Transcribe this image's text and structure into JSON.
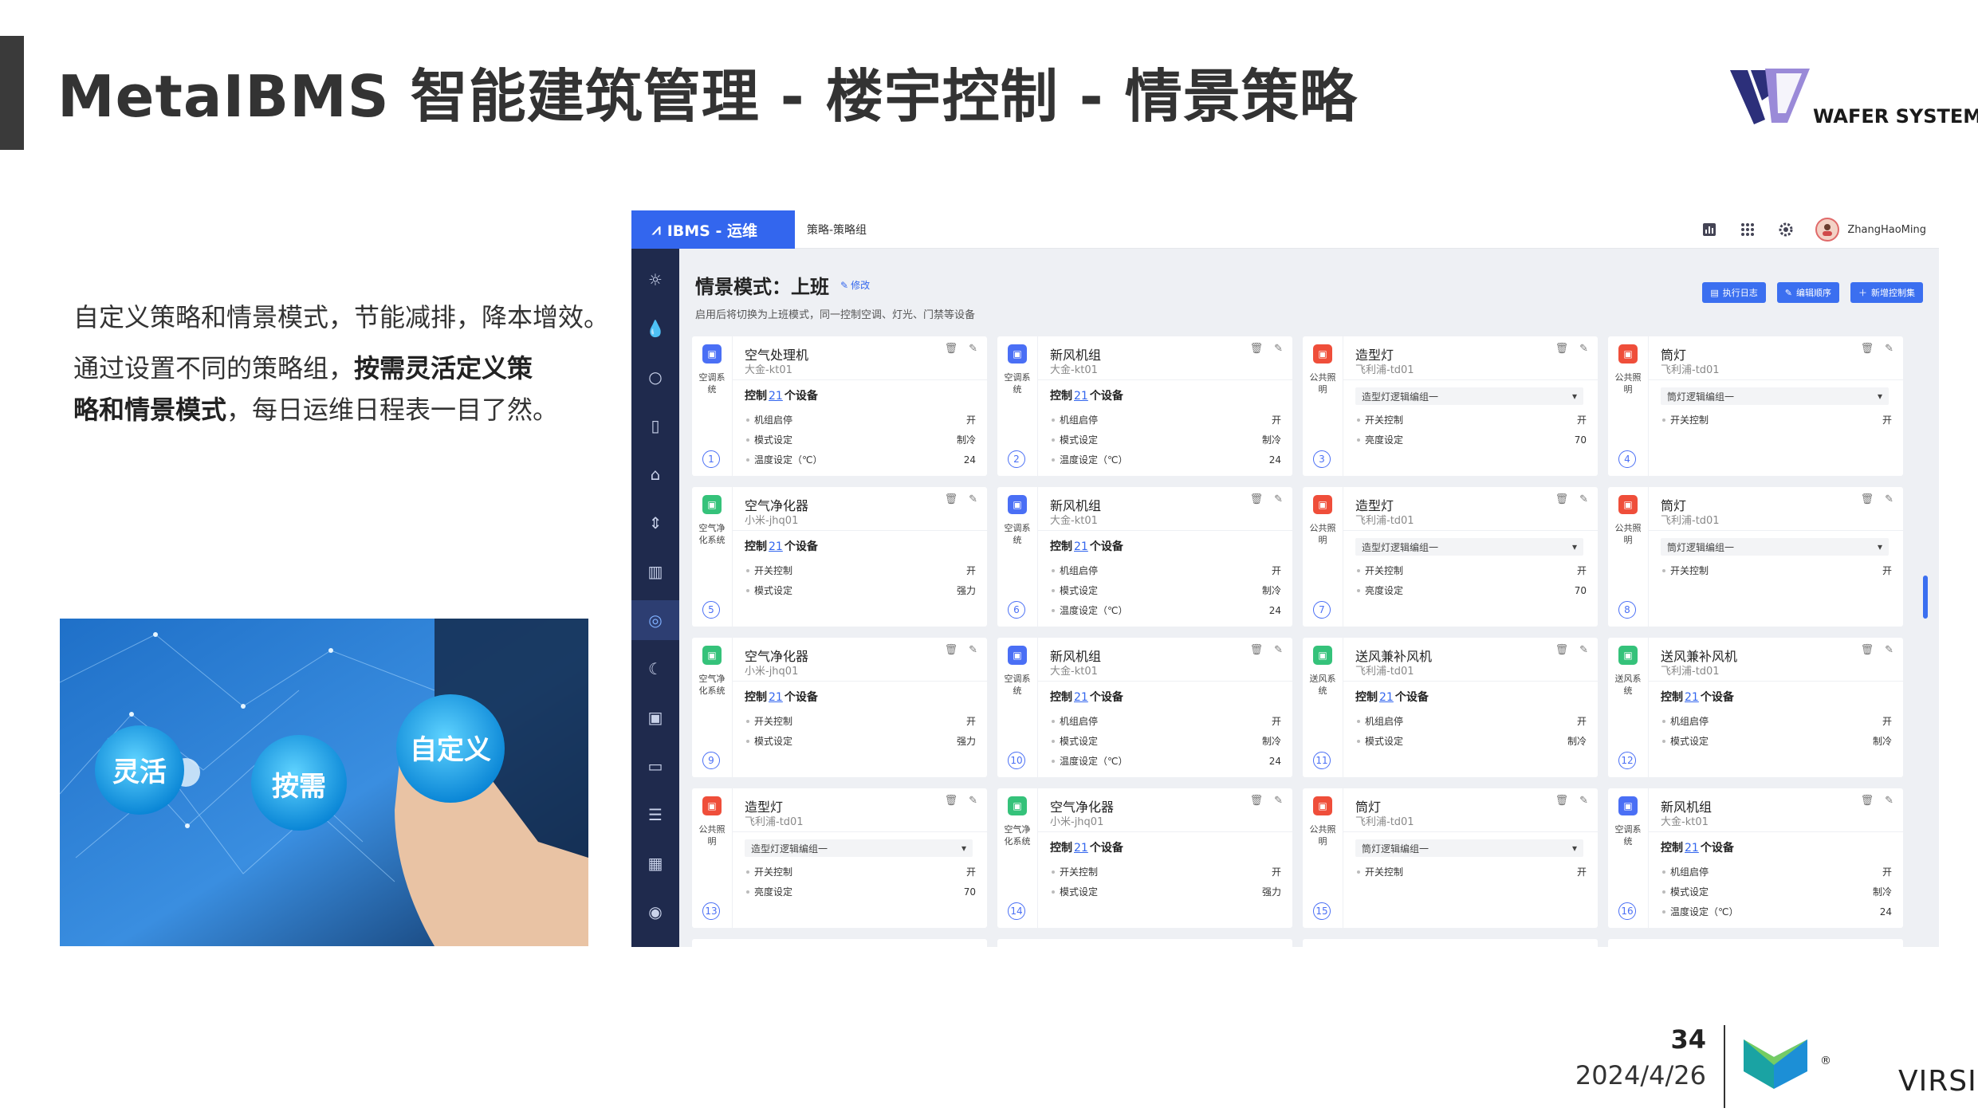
{
  "slide": {
    "title": "MetaIBMS 智能建筑管理 - 楼宇控制 - 情景策略",
    "logo_text": "WAFER SYSTEMS",
    "para1": "自定义策略和情景模式，节能减排，降本增效。",
    "para2_plain1": "通过设置不同的策略组，",
    "para2_bold1": "按需灵活定义策",
    "para2_bold2": "略和情景模式",
    "para2_plain2": "，每日运维日程表一目了然。",
    "photo_labels": [
      "灵活",
      "按需",
      "自定义"
    ],
    "page_number": "34",
    "date": "2024/4/26",
    "footer_logo_text": "VIRSICAL",
    "footer_reg": "®"
  },
  "app": {
    "brand": "IBMS - 运维",
    "breadcrumb": "策略-策略组",
    "user": "ZhangHaoMing",
    "title": "情景模式：上班",
    "edit_label": "修改",
    "subtitle": "启用后将切换为上班模式，同一控制空调、灯光、门禁等设备",
    "buttons": [
      "执行日志",
      "编辑顺序",
      "新增控制集"
    ],
    "sidebar_icons": [
      "sun-icon",
      "water-drop-icon",
      "bulb-icon",
      "document-icon",
      "home-icon",
      "elevator-icon",
      "chart-icon",
      "strategy-icon",
      "moon-icon",
      "chip-icon",
      "display-icon",
      "ticket-icon",
      "calendar-icon",
      "fingerprint-icon"
    ],
    "cards": [
      {
        "num": "1",
        "color": "blue",
        "sys": "空调系统",
        "name": "空气处理机",
        "dev": "大金-kt01",
        "ctl_pre": "控制",
        "ctl_n": "21",
        "ctl_post": "个设备",
        "rows": [
          [
            "机组启停",
            "开"
          ],
          [
            "模式设定",
            "制冷"
          ],
          [
            "温度设定（℃）",
            "24"
          ]
        ]
      },
      {
        "num": "2",
        "color": "blue",
        "sys": "空调系统",
        "name": "新风机组",
        "dev": "大金-kt01",
        "ctl_pre": "控制",
        "ctl_n": "21",
        "ctl_post": "个设备",
        "rows": [
          [
            "机组启停",
            "开"
          ],
          [
            "模式设定",
            "制冷"
          ],
          [
            "温度设定（℃）",
            "24"
          ]
        ]
      },
      {
        "num": "3",
        "color": "red",
        "sys": "公共照明",
        "name": "造型灯",
        "dev": "飞利浦-td01",
        "select": "造型灯逻辑编组一",
        "rows": [
          [
            "开关控制",
            "开"
          ],
          [
            "亮度设定",
            "70"
          ]
        ]
      },
      {
        "num": "4",
        "color": "red",
        "sys": "公共照明",
        "name": "筒灯",
        "dev": "飞利浦-td01",
        "select": "筒灯逻辑编组一",
        "rows": [
          [
            "开关控制",
            "开"
          ]
        ]
      },
      {
        "num": "5",
        "color": "green",
        "sys": "空气净化系统",
        "name": "空气净化器",
        "dev": "小米-jhq01",
        "ctl_pre": "控制",
        "ctl_n": "21",
        "ctl_post": "个设备",
        "rows": [
          [
            "开关控制",
            "开"
          ],
          [
            "模式设定",
            "强力"
          ]
        ]
      },
      {
        "num": "6",
        "color": "blue",
        "sys": "空调系统",
        "name": "新风机组",
        "dev": "大金-kt01",
        "ctl_pre": "控制",
        "ctl_n": "21",
        "ctl_post": "个设备",
        "rows": [
          [
            "机组启停",
            "开"
          ],
          [
            "模式设定",
            "制冷"
          ],
          [
            "温度设定（℃）",
            "24"
          ]
        ]
      },
      {
        "num": "7",
        "color": "red",
        "sys": "公共照明",
        "name": "造型灯",
        "dev": "飞利浦-td01",
        "select": "造型灯逻辑编组一",
        "rows": [
          [
            "开关控制",
            "开"
          ],
          [
            "亮度设定",
            "70"
          ]
        ]
      },
      {
        "num": "8",
        "color": "red",
        "sys": "公共照明",
        "name": "筒灯",
        "dev": "飞利浦-td01",
        "select": "筒灯逻辑编组一",
        "rows": [
          [
            "开关控制",
            "开"
          ]
        ]
      },
      {
        "num": "9",
        "color": "green",
        "sys": "空气净化系统",
        "name": "空气净化器",
        "dev": "小米-jhq01",
        "ctl_pre": "控制",
        "ctl_n": "21",
        "ctl_post": "个设备",
        "rows": [
          [
            "开关控制",
            "开"
          ],
          [
            "模式设定",
            "强力"
          ]
        ]
      },
      {
        "num": "10",
        "color": "blue",
        "sys": "空调系统",
        "name": "新风机组",
        "dev": "大金-kt01",
        "ctl_pre": "控制",
        "ctl_n": "21",
        "ctl_post": "个设备",
        "rows": [
          [
            "机组启停",
            "开"
          ],
          [
            "模式设定",
            "制冷"
          ],
          [
            "温度设定（℃）",
            "24"
          ]
        ]
      },
      {
        "num": "11",
        "color": "green",
        "sys": "送风系统",
        "name": "送风兼补风机",
        "dev": "飞利浦-td01",
        "ctl_pre": "控制",
        "ctl_n": "21",
        "ctl_post": "个设备",
        "rows": [
          [
            "机组启停",
            "开"
          ],
          [
            "模式设定",
            "制冷"
          ]
        ]
      },
      {
        "num": "12",
        "color": "green",
        "sys": "送风系统",
        "name": "送风兼补风机",
        "dev": "飞利浦-td01",
        "ctl_pre": "控制",
        "ctl_n": "21",
        "ctl_post": "个设备",
        "rows": [
          [
            "机组启停",
            "开"
          ],
          [
            "模式设定",
            "制冷"
          ]
        ]
      },
      {
        "num": "13",
        "color": "red",
        "sys": "公共照明",
        "name": "造型灯",
        "dev": "飞利浦-td01",
        "select": "造型灯逻辑编组一",
        "rows": [
          [
            "开关控制",
            "开"
          ],
          [
            "亮度设定",
            "70"
          ]
        ]
      },
      {
        "num": "14",
        "color": "green",
        "sys": "空气净化系统",
        "name": "空气净化器",
        "dev": "小米-jhq01",
        "ctl_pre": "控制",
        "ctl_n": "21",
        "ctl_post": "个设备",
        "rows": [
          [
            "开关控制",
            "开"
          ],
          [
            "模式设定",
            "强力"
          ]
        ]
      },
      {
        "num": "15",
        "color": "red",
        "sys": "公共照明",
        "name": "筒灯",
        "dev": "飞利浦-td01",
        "select": "筒灯逻辑编组一",
        "rows": [
          [
            "开关控制",
            "开"
          ]
        ]
      },
      {
        "num": "16",
        "color": "blue",
        "sys": "空调系统",
        "name": "新风机组",
        "dev": "大金-kt01",
        "ctl_pre": "控制",
        "ctl_n": "21",
        "ctl_post": "个设备",
        "rows": [
          [
            "机组启停",
            "开"
          ],
          [
            "模式设定",
            "制冷"
          ],
          [
            "温度设定（℃）",
            "24"
          ]
        ]
      }
    ]
  },
  "colors": {
    "brand_blue": "#3366ee",
    "sidebar": "#1f2a4d",
    "air_con": "#4a6ff5",
    "lighting": "#ef4e3a",
    "purifier": "#35c27a"
  }
}
